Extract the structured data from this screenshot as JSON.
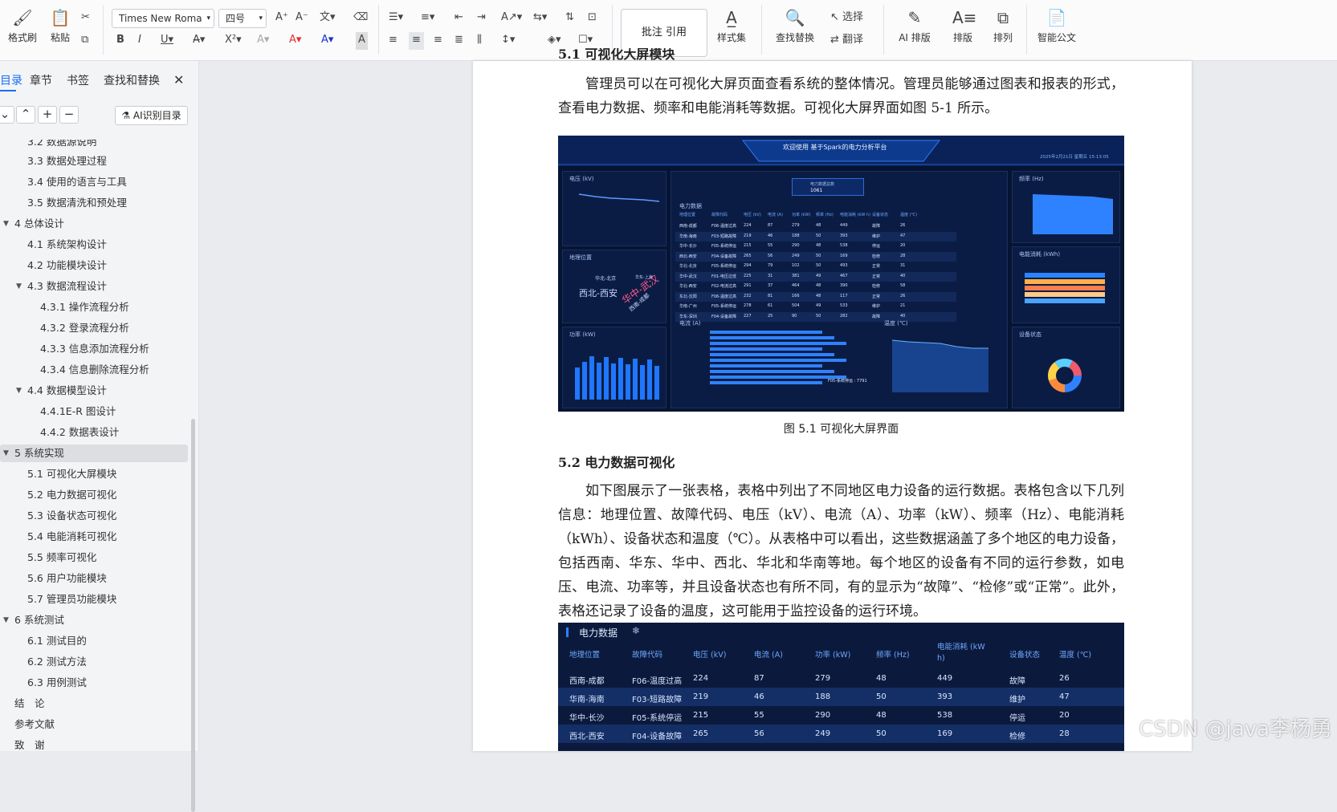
{
  "ribbon": {
    "format_painter": "格式刷",
    "paste": "粘贴",
    "font_name": "Times New Roma",
    "font_size": "四号",
    "style_box": "批注 引用",
    "style_set": "样式集",
    "find_replace": "查找替换",
    "select": "选择",
    "translate": "翻译",
    "ai_layout": "AI 排版",
    "layout": "排版",
    "arrange": "排列",
    "smart_doc": "智能公文"
  },
  "nav": {
    "tabs": [
      "目录",
      "章节",
      "书签",
      "查找和替换"
    ],
    "ai_button": "AI识别目录",
    "toc": [
      {
        "label": "3.2 数据源说明",
        "level": 2
      },
      {
        "label": "3.3 数据处理过程",
        "level": 2
      },
      {
        "label": "3.4 使用的语言与工具",
        "level": 2
      },
      {
        "label": "3.5 数据清洗和预处理",
        "level": 2
      },
      {
        "label": "4 总体设计",
        "level": 1
      },
      {
        "label": "4.1 系统架构设计",
        "level": 2
      },
      {
        "label": "4.2 功能模块设计",
        "level": 2
      },
      {
        "label": "4.3 数据流程设计",
        "level": 2
      },
      {
        "label": "4.3.1 操作流程分析",
        "level": 3
      },
      {
        "label": "4.3.2 登录流程分析",
        "level": 3
      },
      {
        "label": "4.3.3 信息添加流程分析",
        "level": 3
      },
      {
        "label": "4.3.4 信息删除流程分析",
        "level": 3
      },
      {
        "label": "4.4  数据模型设计",
        "level": 2
      },
      {
        "label": "4.4.1E-R 图设计",
        "level": 3
      },
      {
        "label": "4.4.2 数据表设计",
        "level": 3
      },
      {
        "label": "5 系统实现",
        "level": 1
      },
      {
        "label": "5.1 可视化大屏模块",
        "level": 2
      },
      {
        "label": "5.2  电力数据可视化",
        "level": 2
      },
      {
        "label": "5.3  设备状态可视化",
        "level": 2
      },
      {
        "label": "5.4  电能消耗可视化",
        "level": 2
      },
      {
        "label": "5.5  频率可视化",
        "level": 2
      },
      {
        "label": "5.6  用户功能模块",
        "level": 2
      },
      {
        "label": "5.7 管理员功能模块",
        "level": 2
      },
      {
        "label": "6 系统测试",
        "level": 1
      },
      {
        "label": "6.1  测试目的",
        "level": 2
      },
      {
        "label": "6.2  测试方法",
        "level": 2
      },
      {
        "label": "6.3  用例测试",
        "level": 2
      },
      {
        "label": "结　论",
        "level": 0
      },
      {
        "label": "参考文献",
        "level": 0
      },
      {
        "label": "致　谢",
        "level": 0
      }
    ]
  },
  "doc": {
    "cut_heading": "5.1 可视化大屏模块",
    "para1": "管理员可以在可视化大屏页面查看系统的整体情况。管理员能够通过图表和报表的形式，查看电力数据、频率和电能消耗等数据。可视化大屏界面如图 5-1 所示。",
    "fig_caption": "图 5.1  可视化大屏界面",
    "heading2": "5.2  电力数据可视化",
    "para2": "如下图展示了一张表格，表格中列出了不同地区电力设备的运行数据。表格包含以下几列信息：地理位置、故障代码、电压（kV）、电流（A）、功率（kW）、频率（Hz）、电能消耗（kWh）、设备状态和温度（℃）。从表格中可以看出，这些数据涵盖了多个地区的电力设备，包括西南、华东、华中、西北、华北和华南等地。每个地区的设备有不同的运行参数，如电压、电流、功率等，并且设备状态也有所不同，有的显示为“故障”、“检修”或“正常”。此外，表格还记录了设备的温度，这可能用于监控设备的运行环境。"
  },
  "dashboard": {
    "title": "欢迎使用 基于Spark的电力分析平台",
    "datetime": "2025年2月21日  星期五  15:13:05",
    "panel_voltage": "电压 (kV)",
    "panel_location": "地理位置",
    "panel_power": "功率 (kW)",
    "panel_freq": "频率 (Hz)",
    "panel_energy": "电能消耗 (kWh)",
    "panel_status": "设备状态",
    "panel_current": "电流 (A)",
    "panel_temp": "温度 (℃)",
    "panel_table": "电力数据",
    "count_label": "电力数据总数",
    "count_value": "1061",
    "current_tooltip": "F05-系统停运 : 7791",
    "wordcloud": [
      "西北-西安",
      "华中-武汉",
      "华北-北京",
      "西南-成都",
      "华东-上海"
    ]
  },
  "table": {
    "title": "电力数据",
    "headers": [
      "地理位置",
      "故障代码",
      "电压 (kV)",
      "电流 (A)",
      "功率 (kW)",
      "频率 (Hz)",
      "电能消耗 (kW h)",
      "设备状态",
      "温度 (℃)"
    ],
    "rows": [
      [
        "西南-成都",
        "F06-温度过高",
        "224",
        "87",
        "279",
        "48",
        "449",
        "故障",
        "26"
      ],
      [
        "华南-海南",
        "F03-短路故障",
        "219",
        "46",
        "188",
        "50",
        "393",
        "维护",
        "47"
      ],
      [
        "华中-长沙",
        "F05-系统停运",
        "215",
        "55",
        "290",
        "48",
        "538",
        "停运",
        "20"
      ],
      [
        "西北-西安",
        "F04-设备故障",
        "265",
        "56",
        "249",
        "50",
        "169",
        "检修",
        "28"
      ]
    ],
    "dash_rows": [
      [
        "西南-成都",
        "F06-温度过高",
        "224",
        "87",
        "279",
        "48",
        "449",
        "故障",
        "26"
      ],
      [
        "华南-海南",
        "F03-短路故障",
        "219",
        "46",
        "188",
        "50",
        "393",
        "维护",
        "47"
      ],
      [
        "华中-长沙",
        "F05-系统停运",
        "215",
        "55",
        "290",
        "48",
        "538",
        "停运",
        "20"
      ],
      [
        "西北-西安",
        "F04-设备故障",
        "265",
        "56",
        "249",
        "50",
        "169",
        "检修",
        "28"
      ],
      [
        "华北-北京",
        "F05-系统停运",
        "294",
        "79",
        "102",
        "50",
        "493",
        "正常",
        "31"
      ],
      [
        "华中-武汉",
        "F01-电压过低",
        "225",
        "31",
        "381",
        "49",
        "467",
        "正常",
        "40"
      ],
      [
        "华北-西安",
        "F02-电流过高",
        "291",
        "37",
        "464",
        "48",
        "390",
        "检修",
        "58"
      ],
      [
        "东北-沈阳",
        "F06-温度过高",
        "232",
        "81",
        "166",
        "48",
        "117",
        "正常",
        "26"
      ],
      [
        "华南-广州",
        "F05-系统停运",
        "278",
        "61",
        "504",
        "49",
        "533",
        "维护",
        "21"
      ],
      [
        "华东-深圳",
        "F04-设备故障",
        "227",
        "25",
        "90",
        "50",
        "282",
        "故障",
        "40"
      ]
    ]
  },
  "watermark": "CSDN @java李杨勇",
  "colors": {
    "accent": "#1a6ef5",
    "dash_bg": "#061433",
    "bar": "#1f77ff"
  }
}
